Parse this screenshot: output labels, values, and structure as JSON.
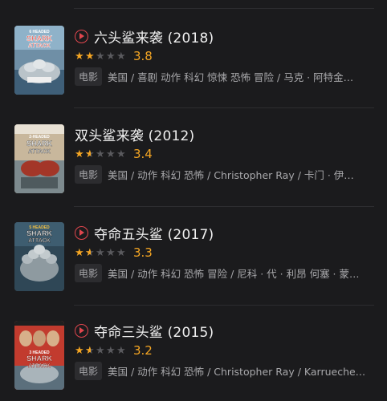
{
  "theme": {
    "background": "#1b1b1d",
    "accent_star": "#f5a623",
    "play_icon_color": "#e0464e"
  },
  "movies": [
    {
      "title": "六头鲨来袭 (2018)",
      "has_play": true,
      "rating_stars": 2,
      "score": "3.8",
      "tag": "电影",
      "meta": "美国 / 喜剧 动作 科幻 惊悚 恐怖 冒险 / 马克 · 阿特金…",
      "poster_text": [
        "6 HEADED",
        "SHARK",
        "ATTACK"
      ]
    },
    {
      "title": "双头鲨来袭 (2012)",
      "has_play": false,
      "rating_stars": 1.5,
      "score": "3.4",
      "tag": "电影",
      "meta": "美国 / 动作 科幻 恐怖 / Christopher Ray / 卡门 · 伊…",
      "poster_text": [
        "2-HEADED",
        "SHARK",
        "ATTACK"
      ]
    },
    {
      "title": "夺命五头鲨 (2017)",
      "has_play": true,
      "rating_stars": 1.5,
      "score": "3.3",
      "tag": "电影",
      "meta": "美国 / 动作 科幻 恐怖 冒险 / 尼科 · 代 · 利昂 何塞 · 蒙…",
      "poster_text": [
        "5 HEADED",
        "SHARK",
        "ATTACK"
      ]
    },
    {
      "title": "夺命三头鲨 (2015)",
      "has_play": true,
      "rating_stars": 1.5,
      "score": "3.2",
      "tag": "电影",
      "meta": "美国 / 动作 科幻 恐怖 / Christopher Ray / Karrueche…",
      "poster_text": [
        "3 HEADED",
        "SHARK",
        "ATTACK"
      ]
    }
  ]
}
